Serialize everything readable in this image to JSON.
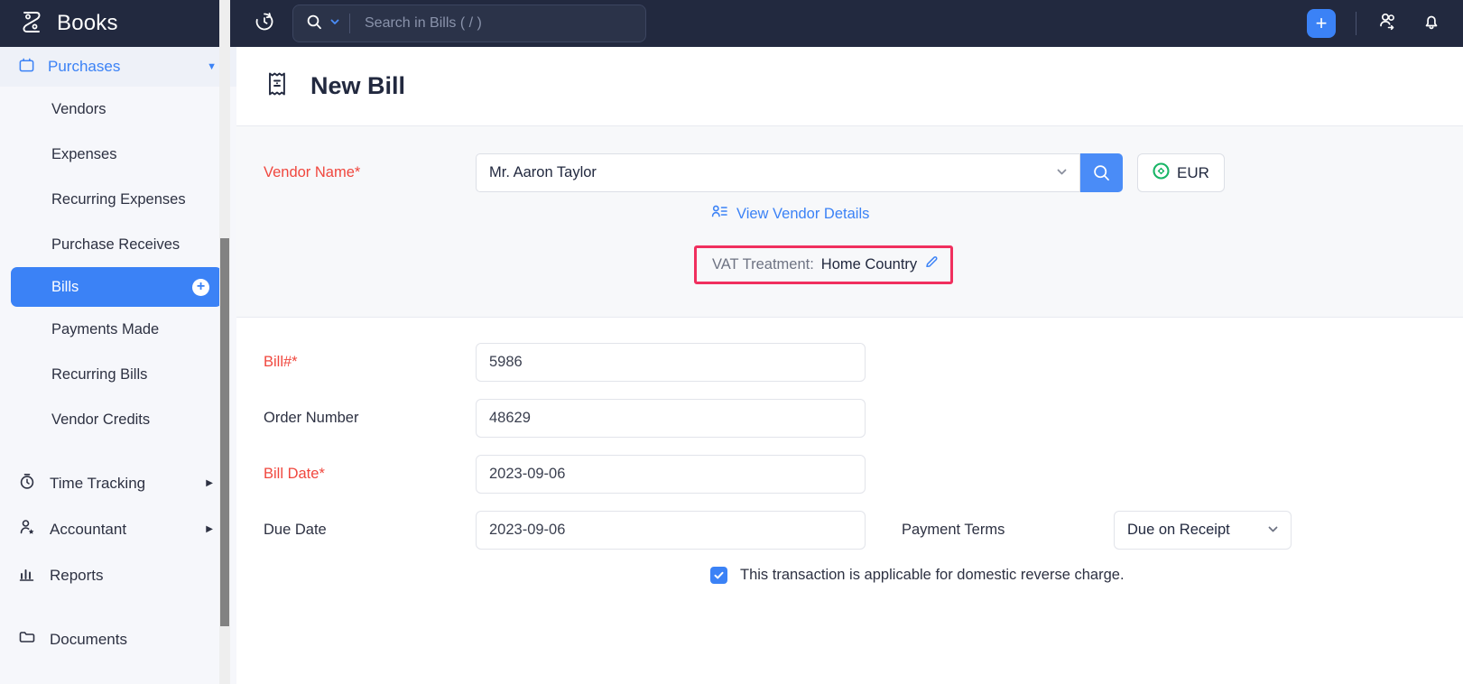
{
  "brand": {
    "name": "Books",
    "logo_icon": "books-logo-icon"
  },
  "sidebar": {
    "group": {
      "label": "Purchases",
      "icon": "bag-icon",
      "caret": "▼"
    },
    "sub_items": [
      {
        "label": "Vendors"
      },
      {
        "label": "Expenses"
      },
      {
        "label": "Recurring Expenses"
      },
      {
        "label": "Purchase Receives"
      },
      {
        "label": "Bills",
        "active": true,
        "add_badge": "+"
      },
      {
        "label": "Payments Made"
      },
      {
        "label": "Recurring Bills"
      },
      {
        "label": "Vendor Credits"
      }
    ],
    "main_items": [
      {
        "label": "Time Tracking",
        "icon": "stopwatch-icon",
        "caret": "▶"
      },
      {
        "label": "Accountant",
        "icon": "accountant-icon",
        "caret": "▶"
      },
      {
        "label": "Reports",
        "icon": "bar-chart-icon",
        "caret": ""
      },
      {
        "label": "Documents",
        "icon": "folder-icon",
        "caret": ""
      }
    ]
  },
  "topbar": {
    "history_icon": "clock-history-icon",
    "search": {
      "icon": "search-icon",
      "caret": "chevron-down-icon",
      "placeholder": "Search in Bills ( / )",
      "value": ""
    },
    "add_button": {
      "label": "+",
      "icon": "plus-icon"
    },
    "referral_icon": "people-referral-icon",
    "bell_icon": "notification-bell-icon"
  },
  "page": {
    "title": "New Bill",
    "icon": "bill-receipt-icon"
  },
  "vendor": {
    "label": "Vendor Name*",
    "value": "Mr. Aaron Taylor",
    "search_icon": "search-icon",
    "chevron": "⌄",
    "currency": {
      "code": "EUR",
      "icon": "currency-globe-icon"
    },
    "details_link": {
      "label": "View Vendor Details",
      "icon": "vendor-details-icon"
    },
    "vat": {
      "label": "VAT Treatment:",
      "value": "Home Country",
      "edit_icon": "pencil-edit-icon"
    }
  },
  "form": {
    "fields": [
      {
        "label": "Bill#*",
        "value": "5986",
        "required": true
      },
      {
        "label": "Order Number",
        "value": "48629",
        "required": false
      },
      {
        "label": "Bill Date*",
        "value": "2023-09-06",
        "required": true
      },
      {
        "label": "Due Date",
        "value": "2023-09-06",
        "required": false
      }
    ],
    "payment_terms": {
      "label": "Payment Terms",
      "value": "Due on Receipt",
      "chevron": "⌄"
    },
    "reverse_charge": {
      "label": "This transaction is applicable for domestic reverse charge.",
      "checked": true,
      "check_glyph": "✓"
    }
  },
  "colors": {
    "accent": "#3b82f6",
    "required": "#f0473e",
    "highlight": "#f02f5e",
    "header_bg": "#22293f",
    "currency_green": "#18b566"
  }
}
